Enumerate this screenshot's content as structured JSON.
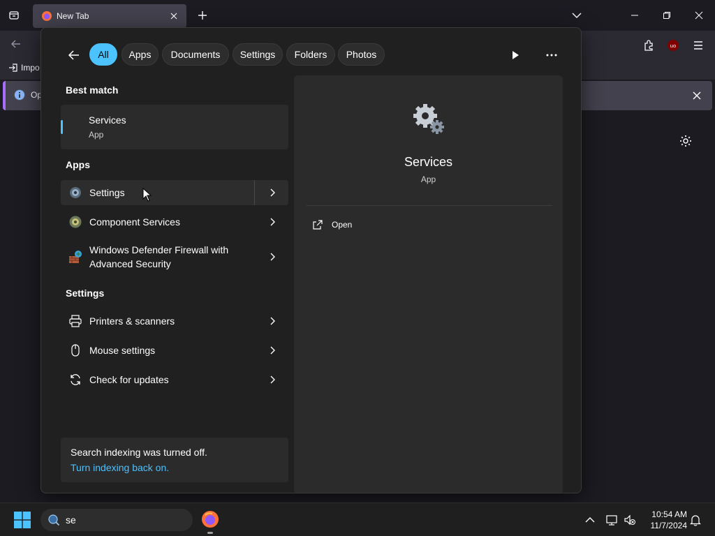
{
  "browser": {
    "tab_title": "New Tab",
    "bookmark_label": "Impo",
    "notification_text": "Op"
  },
  "search": {
    "filters": [
      "All",
      "Apps",
      "Documents",
      "Settings",
      "Folders",
      "Photos"
    ],
    "active_filter": "All",
    "best_match_label": "Best match",
    "best_match": {
      "name": "Services",
      "type": "App"
    },
    "apps_label": "Apps",
    "apps": [
      {
        "label": "Settings",
        "icon": "settings-gear-icon"
      },
      {
        "label": "Component Services",
        "icon": "component-services-icon"
      },
      {
        "label": "Windows Defender Firewall with Advanced Security",
        "icon": "firewall-icon"
      }
    ],
    "settings_label": "Settings",
    "settings": [
      {
        "label": "Printers & scanners",
        "icon": "printer-icon"
      },
      {
        "label": "Mouse settings",
        "icon": "mouse-icon"
      },
      {
        "label": "Check for updates",
        "icon": "sync-icon"
      }
    ],
    "indexing_text": "Search indexing was turned off.",
    "indexing_link": "Turn indexing back on.",
    "preview": {
      "name": "Services",
      "type": "App",
      "action": "Open"
    }
  },
  "taskbar": {
    "search_query": "se",
    "time": "10:54 AM",
    "date": "11/7/2024"
  },
  "colors": {
    "accent": "#4cc2ff",
    "panel_bg": "#202020",
    "card_bg": "#2b2b2b"
  }
}
